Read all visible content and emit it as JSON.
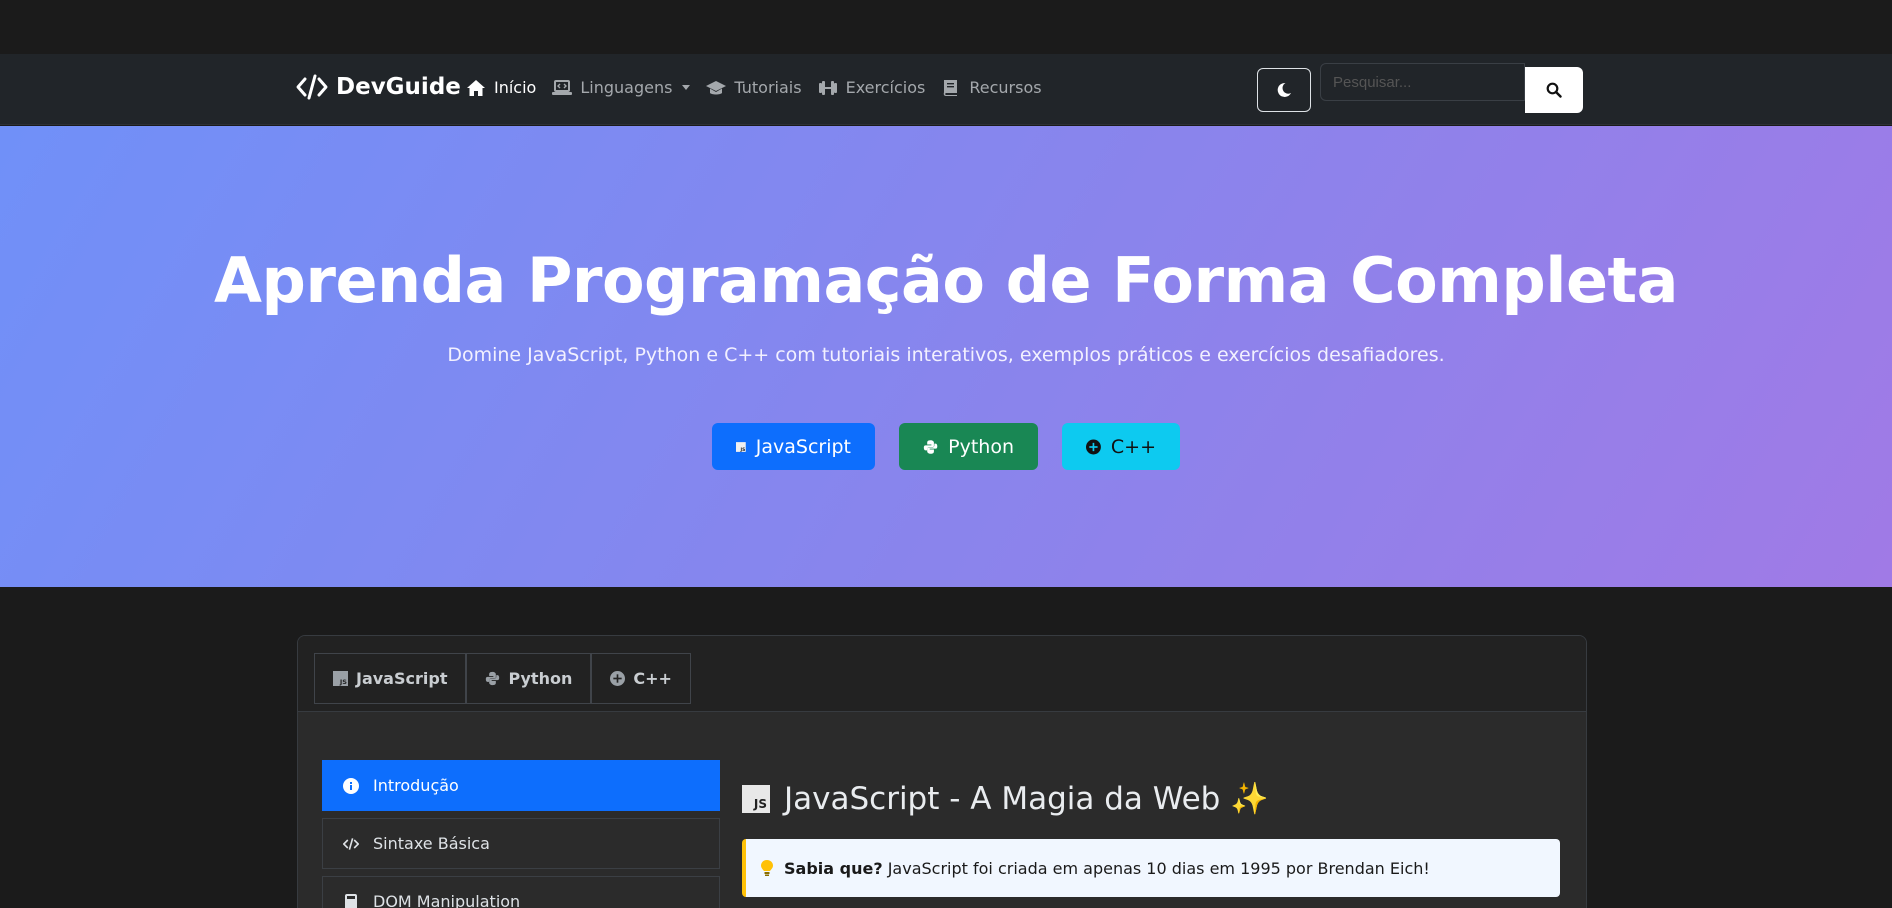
{
  "brand": {
    "name": "DevGuide",
    "icon": "code-icon"
  },
  "nav": {
    "items": [
      {
        "label": "Início",
        "icon": "home-icon",
        "active": true
      },
      {
        "label": "Linguagens",
        "icon": "laptop-code-icon",
        "dropdown": true
      },
      {
        "label": "Tutoriais",
        "icon": "graduation-cap-icon"
      },
      {
        "label": "Exercícios",
        "icon": "dumbbell-icon"
      },
      {
        "label": "Recursos",
        "icon": "book-icon"
      }
    ],
    "theme_toggle_icon": "moon-icon",
    "search": {
      "placeholder": "Pesquisar...",
      "value": "",
      "button_icon": "search-icon"
    }
  },
  "hero": {
    "title": "Aprenda Programação de Forma Completa",
    "subtitle": "Domine JavaScript, Python e C++ com tutoriais interativos, exemplos práticos e exercícios desafiadores.",
    "buttons": [
      {
        "label": "JavaScript",
        "icon": "js-icon",
        "color": "#0d6efd"
      },
      {
        "label": "Python",
        "icon": "python-icon",
        "color": "#198754"
      },
      {
        "label": "C++",
        "icon": "plus-circle-icon",
        "color": "#0dcaf0"
      }
    ],
    "gradient": [
      "#7090f8",
      "#a07ae6"
    ]
  },
  "tabs": [
    {
      "label": "JavaScript",
      "icon": "js-icon"
    },
    {
      "label": "Python",
      "icon": "python-icon"
    },
    {
      "label": "C++",
      "icon": "plus-circle-icon"
    }
  ],
  "sidebar": {
    "items": [
      {
        "label": "Introdução",
        "icon": "info-circle-icon",
        "active": true
      },
      {
        "label": "Sintaxe Básica",
        "icon": "code-icon"
      },
      {
        "label": "DOM Manipulation",
        "icon": "calculator-icon"
      }
    ]
  },
  "content": {
    "badge": "JS",
    "title": "JavaScript - A Magia da Web ✨",
    "tip": {
      "icon": "lightbulb-icon",
      "label": "Sabia que?",
      "text": "JavaScript foi criada em apenas 10 dias em 1995 por Brendan Eich!"
    }
  },
  "colors": {
    "primary": "#0d6efd",
    "success": "#198754",
    "info": "#0dcaf0",
    "warning": "#ffc107",
    "navbar": "#212529",
    "background": "#1b1b1b"
  }
}
